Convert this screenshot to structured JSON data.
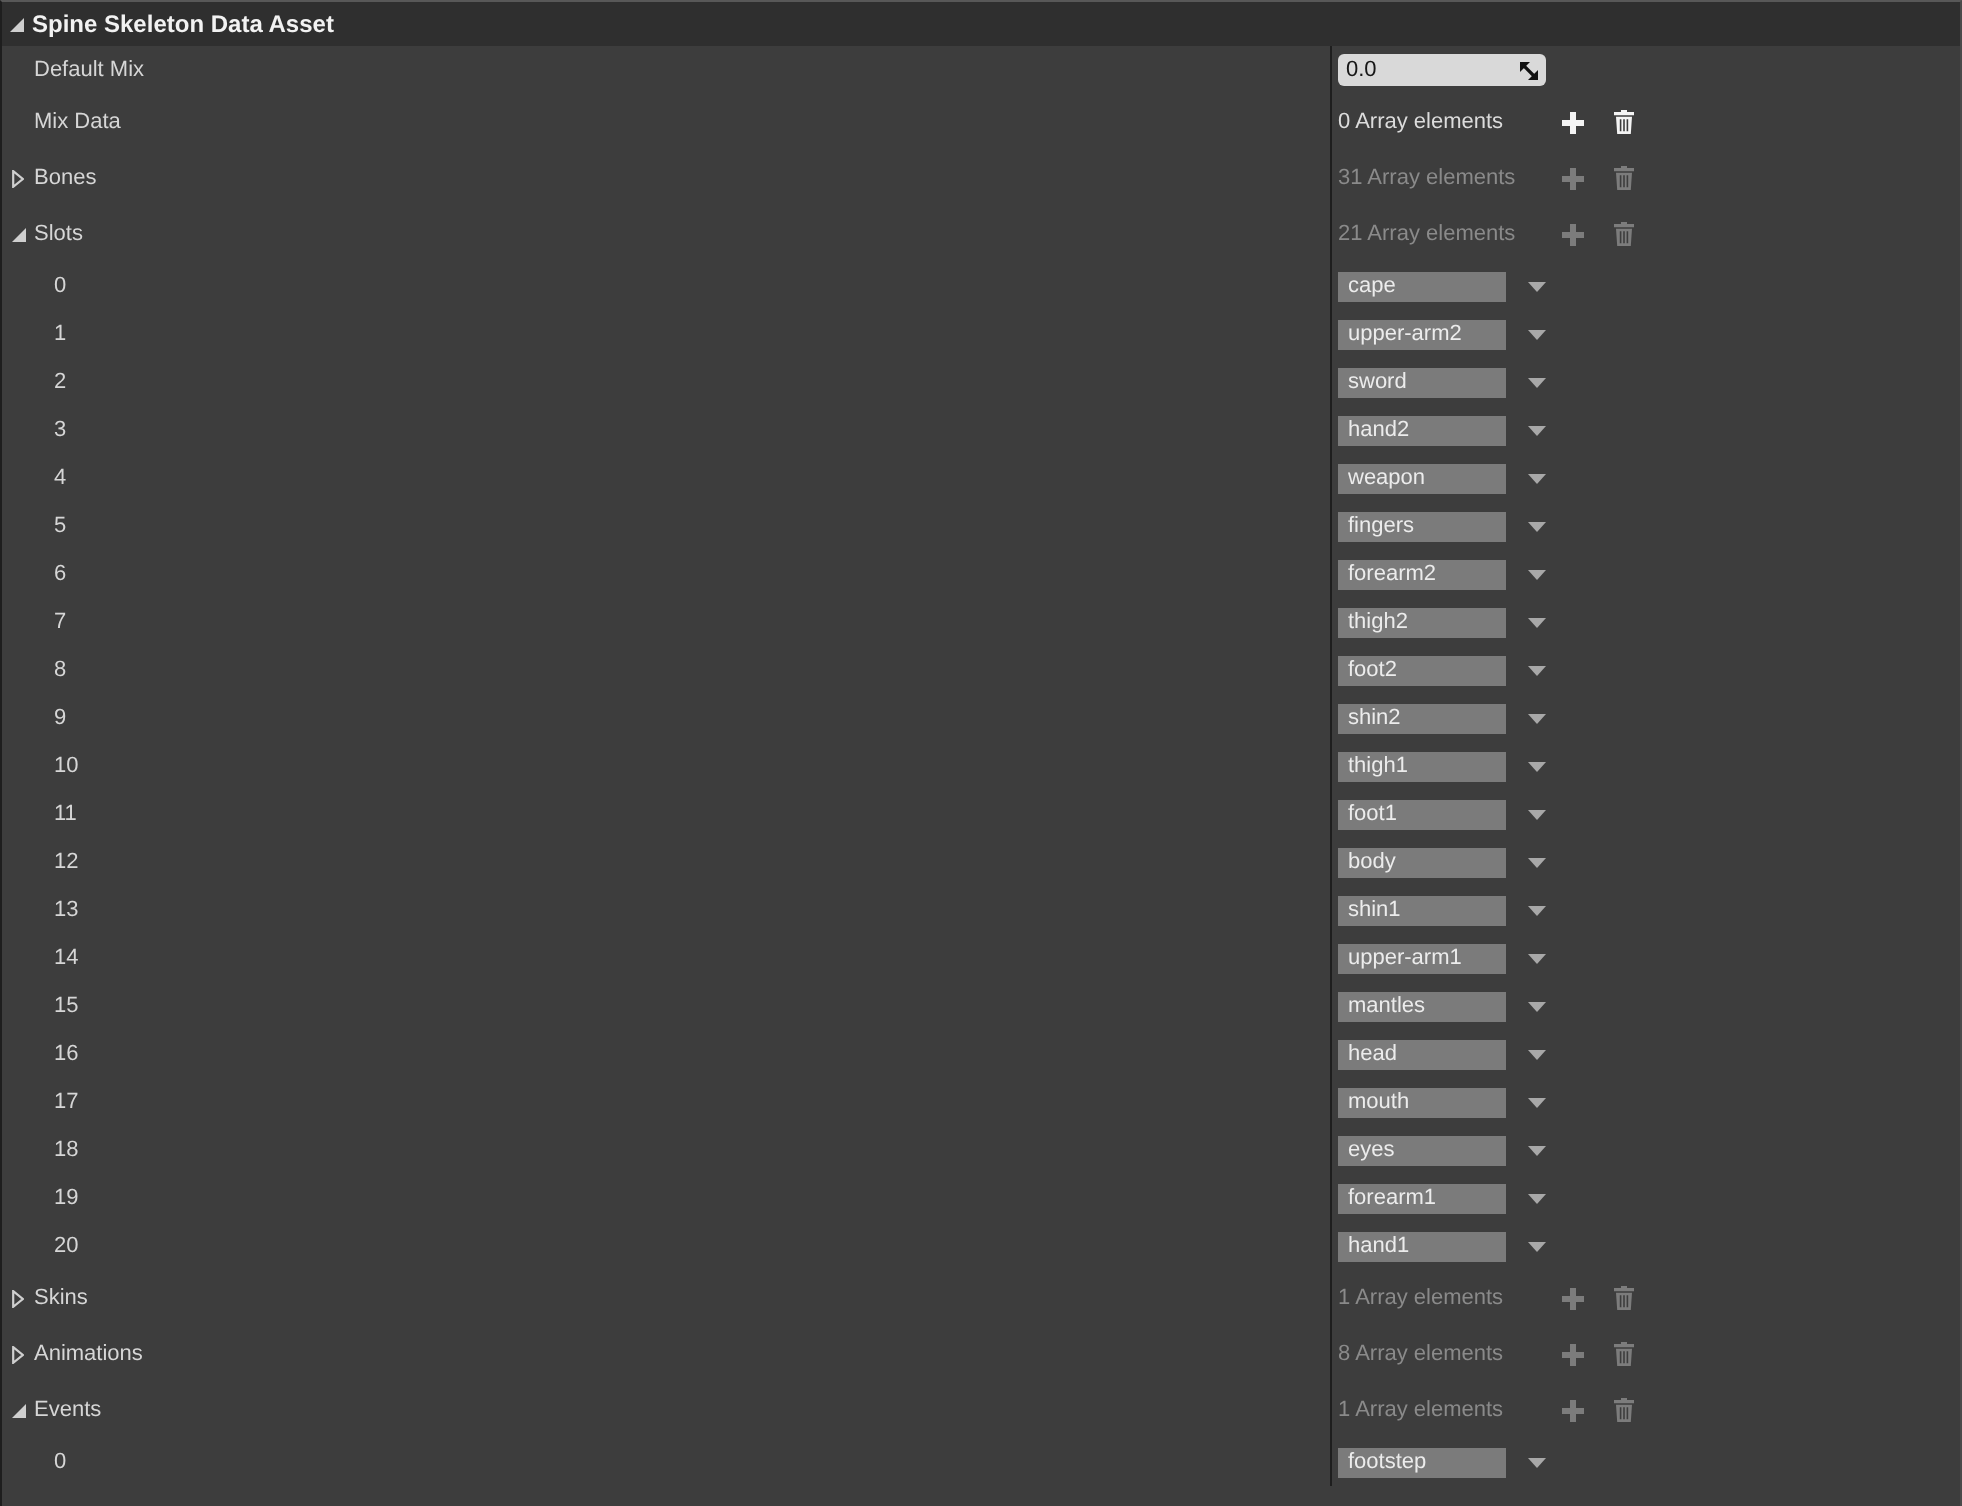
{
  "panel": {
    "title": "Spine Skeleton Data Asset",
    "expanded": true
  },
  "properties": [
    {
      "kind": "number",
      "label": "Default Mix",
      "value": "0.0"
    },
    {
      "kind": "array",
      "label": "Mix Data",
      "count": "0 Array elements",
      "disabled": false
    },
    {
      "kind": "array",
      "label": "Bones",
      "count": "31 Array elements",
      "disabled": true,
      "expanded": false
    },
    {
      "kind": "array",
      "label": "Slots",
      "count": "21 Array elements",
      "disabled": true,
      "expanded": true,
      "children": [
        {
          "index": "0",
          "value": "cape"
        },
        {
          "index": "1",
          "value": "upper-arm2"
        },
        {
          "index": "2",
          "value": "sword"
        },
        {
          "index": "3",
          "value": "hand2"
        },
        {
          "index": "4",
          "value": "weapon"
        },
        {
          "index": "5",
          "value": "fingers"
        },
        {
          "index": "6",
          "value": "forearm2"
        },
        {
          "index": "7",
          "value": "thigh2"
        },
        {
          "index": "8",
          "value": "foot2"
        },
        {
          "index": "9",
          "value": "shin2"
        },
        {
          "index": "10",
          "value": "thigh1"
        },
        {
          "index": "11",
          "value": "foot1"
        },
        {
          "index": "12",
          "value": "body"
        },
        {
          "index": "13",
          "value": "shin1"
        },
        {
          "index": "14",
          "value": "upper-arm1"
        },
        {
          "index": "15",
          "value": "mantles"
        },
        {
          "index": "16",
          "value": "head"
        },
        {
          "index": "17",
          "value": "mouth"
        },
        {
          "index": "18",
          "value": "eyes"
        },
        {
          "index": "19",
          "value": "forearm1"
        },
        {
          "index": "20",
          "value": "hand1"
        }
      ]
    },
    {
      "kind": "array",
      "label": "Skins",
      "count": "1 Array elements",
      "disabled": true,
      "expanded": false
    },
    {
      "kind": "array",
      "label": "Animations",
      "count": "8 Array elements",
      "disabled": true,
      "expanded": false
    },
    {
      "kind": "array",
      "label": "Events",
      "count": "1 Array elements",
      "disabled": true,
      "expanded": true,
      "children": [
        {
          "index": "0",
          "value": "footstep"
        }
      ]
    }
  ]
}
